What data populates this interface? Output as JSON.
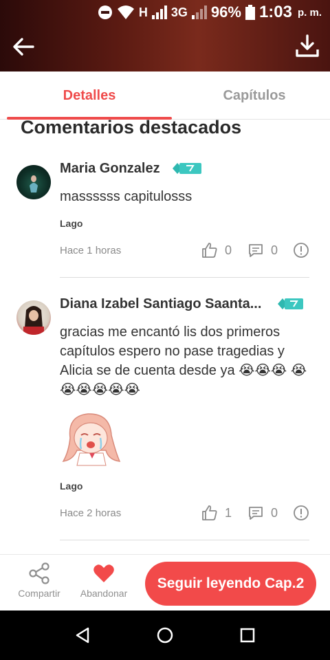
{
  "status_bar": {
    "network": "H",
    "network_3g": "3G",
    "battery": "96%",
    "time": "1:03",
    "ampm": "p. m."
  },
  "header": {
    "back_icon": "arrow-left-icon",
    "download_icon": "download-icon"
  },
  "tabs": [
    {
      "label": "Detalles",
      "active": true
    },
    {
      "label": "Capítulos",
      "active": false
    }
  ],
  "section_title": "Comentarios destacados",
  "comments": [
    {
      "author": "Maria Gonzalez",
      "badge_icon": "level-badge-icon",
      "text": "massssss capitulosss",
      "chapter": "Lago",
      "time_ago": "Hace 1 horas",
      "likes": "0",
      "replies": "0"
    },
    {
      "author": "Diana Izabel Santiago Saanta...",
      "badge_icon": "level-badge-icon",
      "text": "gracias me encantó lis dos primeros capítulos espero no pase tragedias y Alicia se de cuenta desde ya 😭😭😭 😭😭😭😭😭😭",
      "sticker": "crying-girl-sticker",
      "chapter": "Lago",
      "time_ago": "Hace 2 horas",
      "likes": "1",
      "replies": "0"
    }
  ],
  "bottom_bar": {
    "share_label": "Compartir",
    "abandon_label": "Abandonar",
    "cta_label": "Seguir leyendo Cap.2"
  },
  "colors": {
    "accent": "#ef4b4b",
    "header_bg": "#5a1a12",
    "badge": "#3cc7c0"
  }
}
